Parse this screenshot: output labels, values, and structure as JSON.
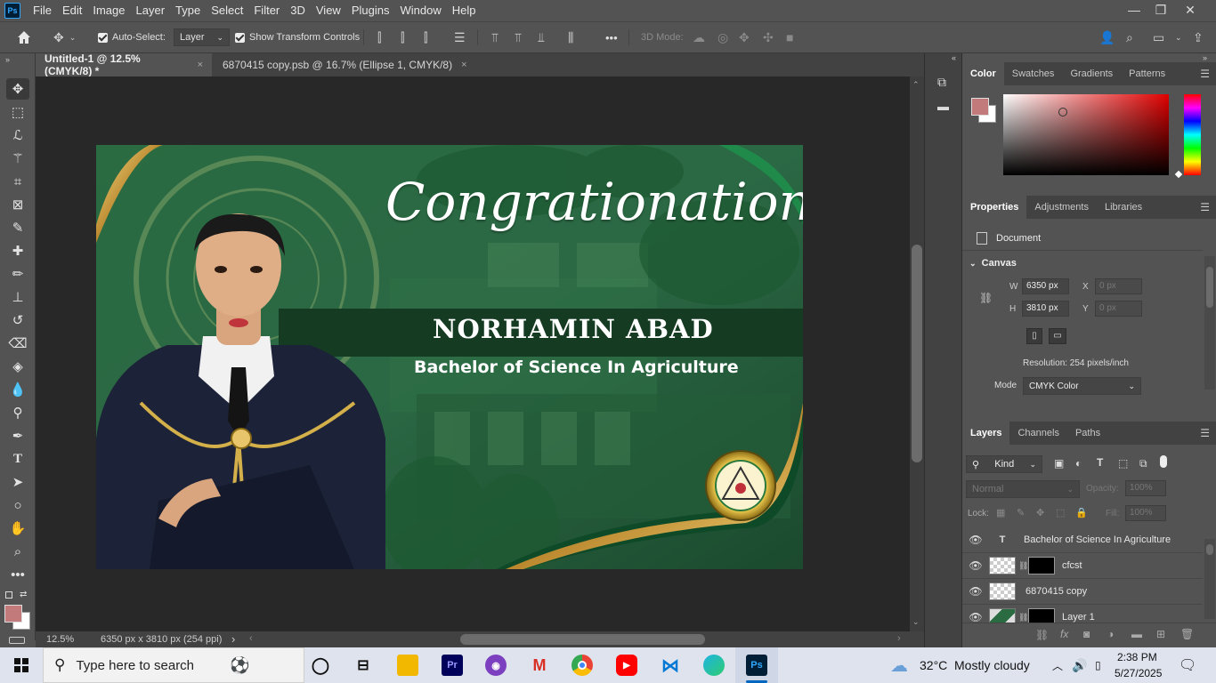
{
  "app": {
    "logo": "Ps"
  },
  "menu": [
    "File",
    "Edit",
    "Image",
    "Layer",
    "Type",
    "Select",
    "Filter",
    "3D",
    "View",
    "Plugins",
    "Window",
    "Help"
  ],
  "options": {
    "auto_select_label": "Auto-Select:",
    "auto_select_value": "Layer",
    "show_transform_label": "Show Transform Controls",
    "mode_3d_label": "3D Mode:",
    "more": "•••"
  },
  "tabs": [
    {
      "label": "Untitled-1 @ 12.5% (CMYK/8) *",
      "close": "×"
    },
    {
      "label": "6870415 copy.psb @ 16.7% (Ellipse 1, CMYK/8)",
      "close": "×"
    }
  ],
  "canvas": {
    "headline": "Congrationation!",
    "name": "NORHAMIN ABAD",
    "degree": "Bachelor of Science In Agriculture",
    "bg_seal_text": "COTABATO FOUNDATION COLLEGE OF SCIENCE & TECHNOLOGY",
    "badge_text": "COTABATO FOUNDATION COLLEGE OF SCIENCE & TECHNOLOGY",
    "badge_bottom": "ARAKAN"
  },
  "status": {
    "zoom": "12.5%",
    "doc_info": "6350 px x 3810 px (254 ppi)",
    "arrow": "›"
  },
  "color_panel": {
    "tabs": [
      "Color",
      "Swatches",
      "Gradients",
      "Patterns"
    ],
    "fg_color": "#c27a7a",
    "bg_color": "#ffffff"
  },
  "properties": {
    "tabs": [
      "Properties",
      "Adjustments",
      "Libraries"
    ],
    "doc_label": "Document",
    "section": "Canvas",
    "w_label": "W",
    "w_value": "6350 px",
    "h_label": "H",
    "h_value": "3810 px",
    "x_label": "X",
    "x_value": "0 px",
    "y_label": "Y",
    "y_value": "0 px",
    "resolution": "Resolution: 254 pixels/inch",
    "mode_label": "Mode",
    "mode_value": "CMYK Color"
  },
  "layers_panel": {
    "tabs": [
      "Layers",
      "Channels",
      "Paths"
    ],
    "kind": "Kind",
    "blend": "Normal",
    "opacity_label": "Opacity:",
    "opacity_value": "100%",
    "lock_label": "Lock:",
    "fill_label": "Fill:",
    "fill_value": "100%",
    "layers": [
      {
        "name": "Bachelor of Science In Agriculture",
        "type": "text"
      },
      {
        "name": "cfcst",
        "type": "smart-mask"
      },
      {
        "name": "6870415 copy",
        "type": "smart"
      },
      {
        "name": "Layer 1",
        "type": "image-mask"
      }
    ]
  },
  "taskbar": {
    "search_placeholder": "Type here to search",
    "weather_temp": "32°C",
    "weather_text": "Mostly cloudy",
    "time": "2:38 PM",
    "date": "5/27/2025",
    "apps": [
      {
        "label": "Pr",
        "color": "#00005b",
        "fg": "#9999ff"
      },
      {
        "label": "Ps",
        "color": "#001e36",
        "fg": "#31a8ff"
      }
    ]
  }
}
